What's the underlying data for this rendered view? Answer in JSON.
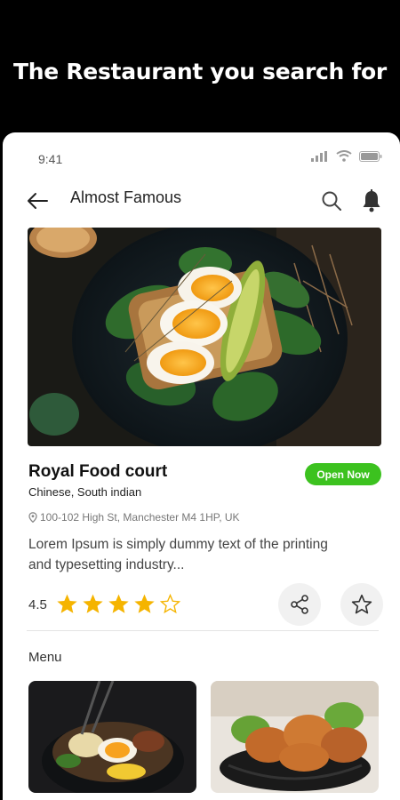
{
  "banner": {
    "title": "The Restaurant you search for"
  },
  "status_bar": {
    "time": "9:41",
    "icons": [
      "signal-icon",
      "wifi-icon",
      "battery-icon"
    ]
  },
  "header": {
    "title": "Almost Famous",
    "icons": [
      "back-arrow-icon",
      "search-icon",
      "bell-icon"
    ]
  },
  "restaurant": {
    "name": "Royal Food court",
    "status": "Open Now",
    "cuisine": "Chinese, South indian",
    "address": "100-102 High St, Manchester M4 1HP, UK",
    "description": "Lorem Ipsum is simply dummy text of the printing and typesetting industry...",
    "rating": "4.5",
    "rating_value": 4,
    "rating_max": 5
  },
  "actions": {
    "icons": [
      "share-icon",
      "favorite-star-icon"
    ]
  },
  "menu": {
    "heading": "Menu",
    "items": [
      "ramen-bowl-photo",
      "fried-chicken-photo"
    ]
  },
  "colors": {
    "accent_green": "#3cc21f",
    "star_gold": "#f5b400",
    "background": "#000000",
    "card": "#ffffff"
  }
}
